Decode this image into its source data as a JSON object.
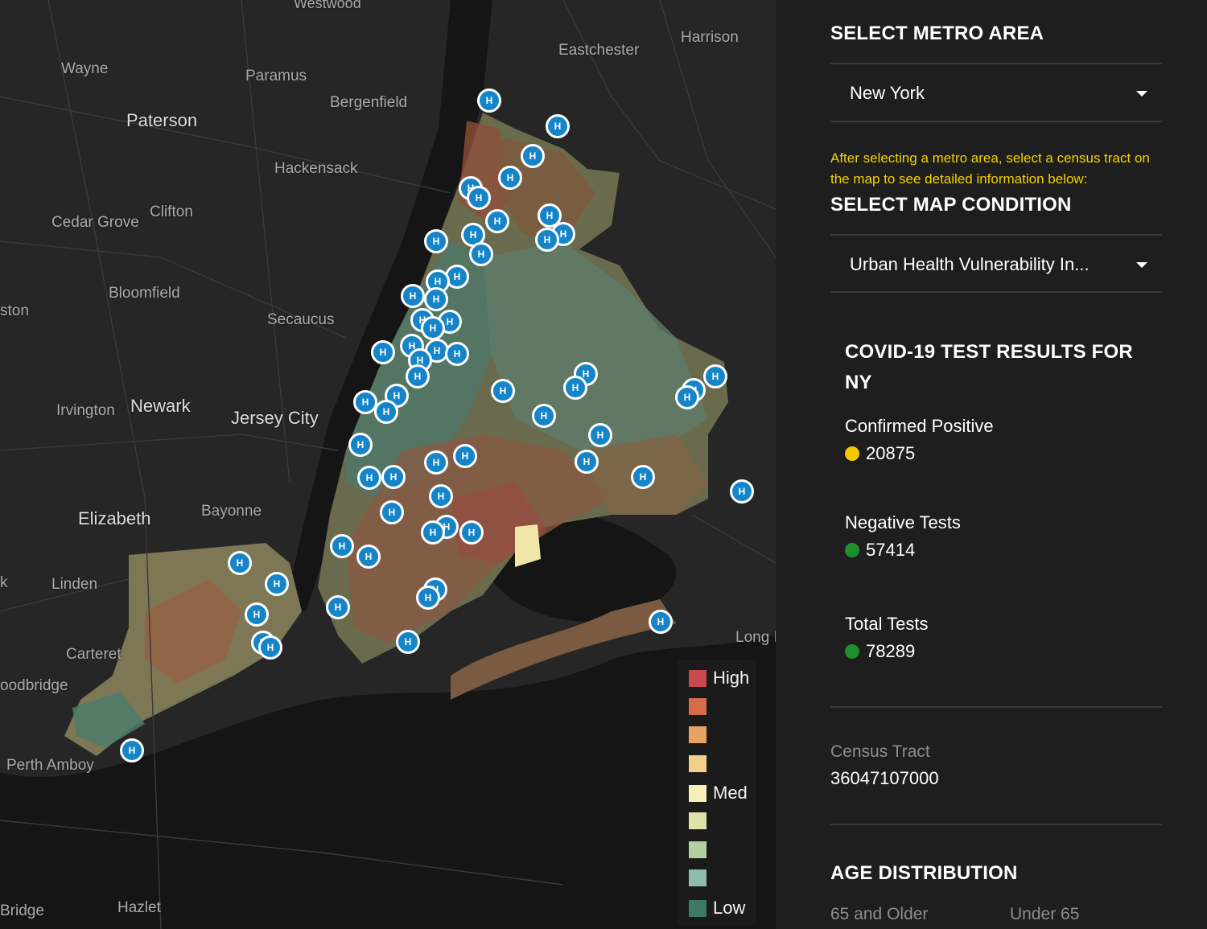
{
  "panel": {
    "metro_heading": "SELECT METRO AREA",
    "metro_value": "New York",
    "hint": "After selecting a metro area, select a census tract on the map to see detailed information below:",
    "condition_heading": "SELECT MAP CONDITION",
    "condition_value": "Urban Health Vulnerability In...",
    "results_heading_line1": "COVID-19 TEST RESULTS FOR",
    "results_heading_line2": "NY",
    "stats": [
      {
        "label": "Confirmed Positive",
        "value": "20875",
        "color": "#f5c800"
      },
      {
        "label": "Negative Tests",
        "value": "57414",
        "color": "#1e8f2f"
      },
      {
        "label": "Total Tests",
        "value": "78289",
        "color": "#1e8f2f"
      }
    ],
    "census_label": "Census Tract",
    "census_value": "36047107000",
    "age_heading": "AGE DISTRIBUTION",
    "age_col1": "65 and Older",
    "age_col2": "Under 65"
  },
  "map": {
    "places": {
      "westwood": "Westwood",
      "wayne": "Wayne",
      "paramus": "Paramus",
      "eastchester": "Eastchester",
      "harrison": "Harrison",
      "bergenfield": "Bergenfield",
      "paterson": "Paterson",
      "hackensack": "Hackensack",
      "clifton": "Clifton",
      "cedar_grove": "Cedar Grove",
      "bloomfield": "Bloomfield",
      "ston": "ston",
      "secaucus": "Secaucus",
      "irvington": "Irvington",
      "newark": "Newark",
      "jersey_city": "Jersey City",
      "elizabeth": "Elizabeth",
      "bayonne": "Bayonne",
      "k": "k",
      "linden": "Linden",
      "carteret": "Carteret",
      "oodbridge": "oodbridge",
      "perth_amboy": "Perth Amboy",
      "bridge": "Bridge",
      "hazlet": "Hazlet",
      "long": "Long I"
    },
    "marker_label": "H",
    "legend": [
      {
        "label": "High",
        "color": "#c9474f"
      },
      {
        "label": "",
        "color": "#d86c4a"
      },
      {
        "label": "",
        "color": "#e8a264"
      },
      {
        "label": "",
        "color": "#f2cf8a"
      },
      {
        "label": "Med",
        "color": "#f6f0b8"
      },
      {
        "label": "",
        "color": "#dfe2a8"
      },
      {
        "label": "",
        "color": "#b3d0a0"
      },
      {
        "label": "",
        "color": "#8dbca8"
      },
      {
        "label": "Low",
        "color": "#3c7a66"
      }
    ]
  }
}
